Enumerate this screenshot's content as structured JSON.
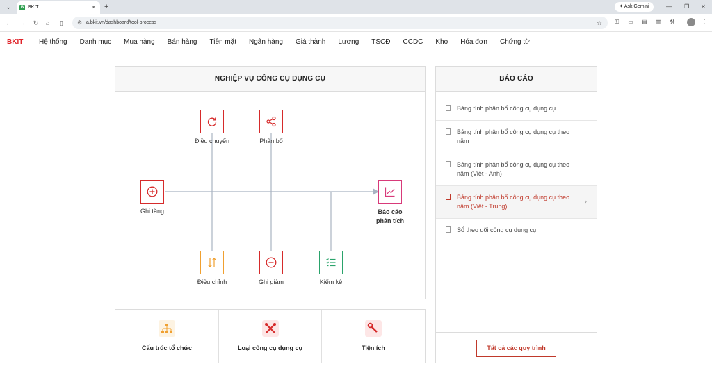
{
  "browser": {
    "tab_title": "BKIT",
    "tab_favicon": "B",
    "url": "a.bkit.vn/dashboard/tool-process",
    "gemini_label": "Ask Gemini"
  },
  "app": {
    "brand": "BKIT",
    "brand_color": "#e0242a",
    "menu": [
      "Hệ thống",
      "Danh mục",
      "Mua hàng",
      "Bán hàng",
      "Tiền mặt",
      "Ngân hàng",
      "Giá thành",
      "Lương",
      "TSCĐ",
      "CCDC",
      "Kho",
      "Hóa đơn",
      "Chứng từ"
    ]
  },
  "process": {
    "title": "NGHIỆP VỤ CÔNG CỤ DỤNG CỤ",
    "nodes": {
      "dieu_chuyen": {
        "label": "Điều chuyển",
        "icon": "rotate-icon",
        "color": "#d62b2b"
      },
      "phan_bo": {
        "label": "Phân bổ",
        "icon": "share-icon",
        "color": "#d62b2b"
      },
      "ghi_tang": {
        "label": "Ghi tăng",
        "icon": "plus-circle-icon",
        "color": "#d62b2b"
      },
      "bao_cao": {
        "label_line1": "Báo cáo",
        "label_line2": "phân tích",
        "icon": "chart-line-icon",
        "color": "#d83a7a"
      },
      "dieu_chinh": {
        "label": "Điều chỉnh",
        "icon": "arrows-up-down-icon",
        "color": "#f0a030"
      },
      "ghi_giam": {
        "label": "Ghi giảm",
        "icon": "minus-circle-icon",
        "color": "#d62b2b"
      },
      "kiem_ke": {
        "label": "Kiểm kê",
        "icon": "checklist-icon",
        "color": "#2aa36b"
      }
    }
  },
  "quick_links": [
    {
      "label": "Cấu trúc tổ chức",
      "icon": "org-chart-icon"
    },
    {
      "label": "Loại công cụ dụng cụ",
      "icon": "tools-icon"
    },
    {
      "label": "Tiện ích",
      "icon": "wrench-icon"
    }
  ],
  "reports": {
    "title": "BÁO CÁO",
    "items": [
      "Bảng tính phân bổ công cụ dụng cụ",
      "Bảng tính phân bổ công cụ dụng cụ theo năm",
      "Bảng tính phân bổ công cụ dụng cụ theo năm (Việt - Anh)",
      "Bảng tính phân bổ công cụ dụng cụ theo năm (Việt - Trung)",
      "Sổ theo dõi công cụ dụng cụ"
    ],
    "active_index": 3,
    "all_button": "Tất cả các quy trình"
  }
}
